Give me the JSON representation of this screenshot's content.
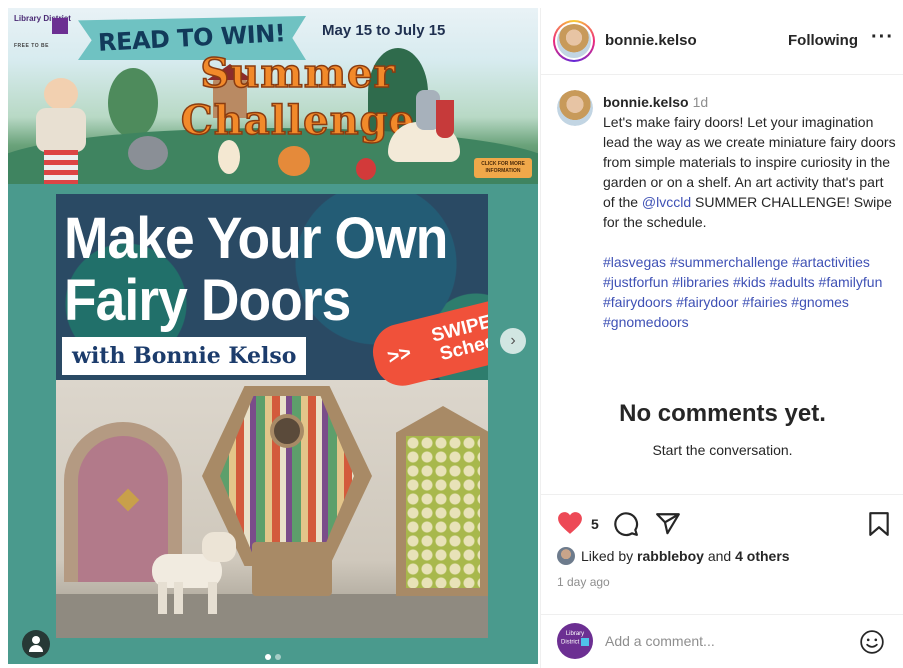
{
  "post": {
    "banner": {
      "library_logo_text": "Library District",
      "library_logo_sub": "FREE TO BE",
      "ribbon_text": "READ TO WIN!",
      "dates": "May 15 to July 15",
      "title": "Summer Challenge",
      "badge_text": "CLICK FOR MORE INFORMATION"
    },
    "poster": {
      "title": "Make Your Own Fairy Doors",
      "byline": "with Bonnie Kelso",
      "swipe_arrows": ">>",
      "swipe_text": "SWIPE for Schedule"
    },
    "carousel": {
      "current": 1,
      "total": 2
    }
  },
  "header": {
    "username": "bonnie.kelso",
    "follow_label": "Following",
    "more_label": "···"
  },
  "caption": {
    "username": "bonnie.kelso",
    "time": "1d",
    "text_before": "Let's make fairy doors! Let your imagination lead the way as we create miniature fairy doors from simple materials to inspire curiosity in the garden or on a shelf. An art activity that's part of the ",
    "mention": "@lvccld",
    "text_after": " SUMMER CHALLENGE! Swipe for the schedule.",
    "hashtags": "#lasvegas #summerchallenge #artactivities #justforfun #libraries #kids #adults #familyfun #fairydoors #fairydoor #fairies #gnomes #gnomedoors"
  },
  "comments": {
    "empty_title": "No comments yet.",
    "empty_sub": "Start the conversation."
  },
  "actions": {
    "like_count": "5",
    "liked_prefix": "Liked by ",
    "liked_user": "rabbleboy",
    "liked_mid": " and ",
    "liked_others": "4 others",
    "posted_ago": "1 day ago",
    "heart_color": "#ed4956"
  },
  "composer": {
    "avatar_text": "Library District",
    "placeholder": "Add a comment..."
  },
  "icons": [
    "heart-icon",
    "comment-icon",
    "share-icon",
    "bookmark-icon",
    "emoji-icon",
    "more-icon",
    "user-tag-icon",
    "chevron-right-icon"
  ]
}
